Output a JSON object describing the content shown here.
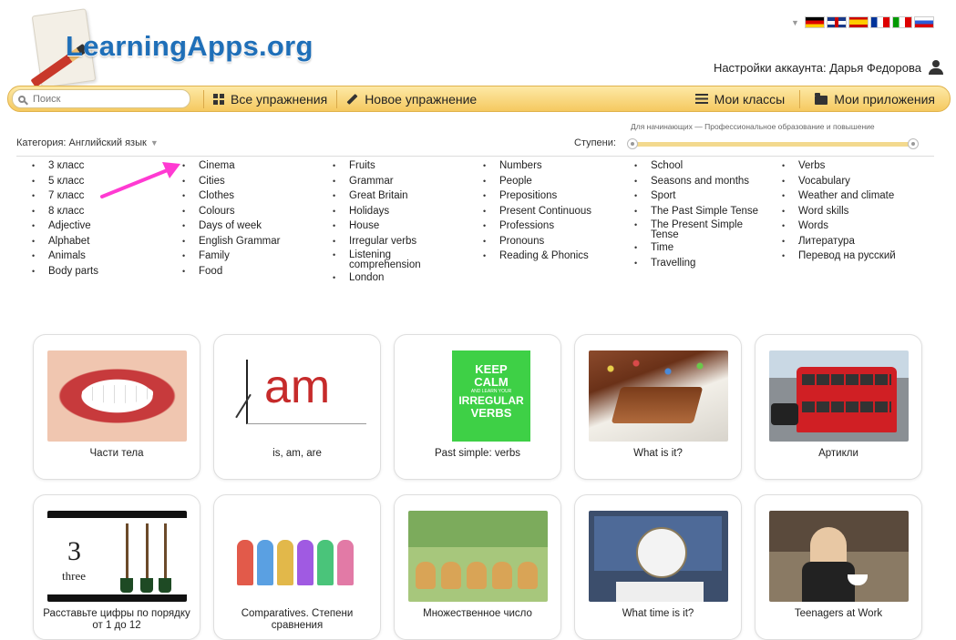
{
  "header": {
    "logo_text": "LearningApps.org",
    "account_label": "Настройки аккаунта: Дарья Федорова",
    "languages": [
      "de",
      "gb",
      "es",
      "fr",
      "it",
      "ru"
    ]
  },
  "nav": {
    "search_placeholder": "Поиск",
    "all_exercises": "Все упражнения",
    "new_exercise": "Новое упражнение",
    "my_classes": "Мои классы",
    "my_apps": "Мои приложения"
  },
  "filter": {
    "category": "Категория: Английский язык",
    "levels_label": "Ступени:",
    "levels_caption": "Для начинающих — Профессиональное образование и повышение",
    "range": [
      0.0,
      1.0
    ]
  },
  "topics": [
    [
      "3 класс",
      "5 класс",
      "7 класс",
      "8 класс",
      "Adjective",
      "Alphabet",
      "Animals",
      "Body parts"
    ],
    [
      "Cinema",
      "Cities",
      "Clothes",
      "Colours",
      "Days of week",
      "English Grammar",
      "Family",
      "Food"
    ],
    [
      "Fruits",
      "Grammar",
      "Great Britain",
      "Holidays",
      "House",
      "Irregular verbs",
      "Listening comprehension",
      "London"
    ],
    [
      "Numbers",
      "People",
      "Prepositions",
      "Present Continuous",
      "Professions",
      "Pronouns",
      "Reading & Phonics"
    ],
    [
      "School",
      "Seasons and months",
      "Sport",
      "The Past Simple Tense",
      "The Present Simple Tense",
      "Time",
      "Travelling"
    ],
    [
      "Verbs",
      "Vocabulary",
      "Weather and climate",
      "Word skills",
      "Words",
      "Литература",
      "Перевод на русский"
    ]
  ],
  "thumb_text": {
    "am": "am",
    "keep_1": "KEEP",
    "keep_2": "CALM",
    "keep_3": "AND LEARN YOUR",
    "keep_4": "IRREGULAR",
    "keep_5": "VERBS",
    "three_num": "3",
    "three_word": "three"
  },
  "cards": [
    {
      "title": "Части тела"
    },
    {
      "title": "is, am, are"
    },
    {
      "title": "Past simple: verbs"
    },
    {
      "title": "What is it?"
    },
    {
      "title": "Артикли"
    },
    {
      "title": "Расставьте цифры по порядку от 1 до 12"
    },
    {
      "title": "Comparatives. Степени сравнения"
    },
    {
      "title": "Множественное число"
    },
    {
      "title": "What time is it?"
    },
    {
      "title": "Teenagers at Work"
    }
  ],
  "colors": {
    "brand_blue": "#1f6fb8",
    "nav_bar": "#f5c960",
    "arrow": "#ff3ad2"
  }
}
